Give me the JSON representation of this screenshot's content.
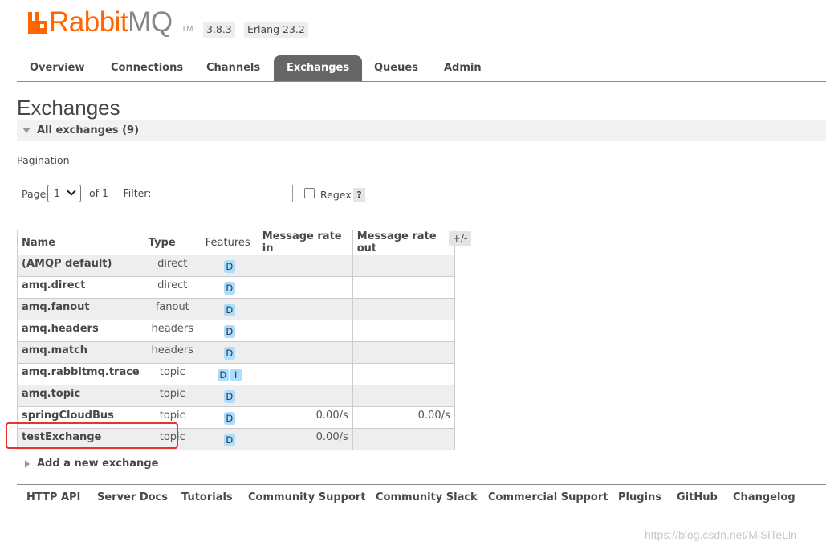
{
  "brand": {
    "rabbit": "Rabbit",
    "mq": "MQ",
    "tm": "TM",
    "accent": "#ff6600"
  },
  "versions": {
    "rabbitmq": "3.8.3",
    "erlang": "Erlang 23.2"
  },
  "nav": {
    "tabs": [
      {
        "label": "Overview",
        "active": false
      },
      {
        "label": "Connections",
        "active": false
      },
      {
        "label": "Channels",
        "active": false
      },
      {
        "label": "Exchanges",
        "active": true
      },
      {
        "label": "Queues",
        "active": false
      },
      {
        "label": "Admin",
        "active": false
      }
    ]
  },
  "page": {
    "title": "Exchanges",
    "section_label": "All exchanges (9)",
    "pagination_label": "Pagination"
  },
  "filters": {
    "page_label": "Page",
    "page_value": "1",
    "of_label": "of 1",
    "filter_label": "- Filter:",
    "filter_value": "",
    "regex_label": "Regex",
    "regex_checked": false,
    "help": "?"
  },
  "table": {
    "columns": [
      "Name",
      "Type",
      "Features",
      "Message rate in",
      "Message rate out"
    ],
    "columns_toggle": "+/-",
    "rows": [
      {
        "name": "(AMQP default)",
        "type": "direct",
        "features": [
          "D"
        ],
        "rate_in": "",
        "rate_out": ""
      },
      {
        "name": "amq.direct",
        "type": "direct",
        "features": [
          "D"
        ],
        "rate_in": "",
        "rate_out": ""
      },
      {
        "name": "amq.fanout",
        "type": "fanout",
        "features": [
          "D"
        ],
        "rate_in": "",
        "rate_out": ""
      },
      {
        "name": "amq.headers",
        "type": "headers",
        "features": [
          "D"
        ],
        "rate_in": "",
        "rate_out": ""
      },
      {
        "name": "amq.match",
        "type": "headers",
        "features": [
          "D"
        ],
        "rate_in": "",
        "rate_out": ""
      },
      {
        "name": "amq.rabbitmq.trace",
        "type": "topic",
        "features": [
          "D",
          "I"
        ],
        "rate_in": "",
        "rate_out": ""
      },
      {
        "name": "amq.topic",
        "type": "topic",
        "features": [
          "D"
        ],
        "rate_in": "",
        "rate_out": ""
      },
      {
        "name": "springCloudBus",
        "type": "topic",
        "features": [
          "D"
        ],
        "rate_in": "0.00/s",
        "rate_out": "0.00/s"
      },
      {
        "name": "testExchange",
        "type": "topic",
        "features": [
          "D"
        ],
        "rate_in": "0.00/s",
        "rate_out": ""
      }
    ]
  },
  "add_exchange": {
    "label": "Add a new exchange"
  },
  "footer": {
    "links": [
      "HTTP API",
      "Server Docs",
      "Tutorials",
      "Community Support",
      "Community Slack",
      "Commercial Support",
      "Plugins",
      "GitHub",
      "Changelog"
    ]
  },
  "watermark": "https://blog.csdn.net/MiSiTeLin",
  "colors": {
    "highlight": "#e8332c",
    "feature_badge": "#aaddff",
    "active_tab": "#666666"
  }
}
